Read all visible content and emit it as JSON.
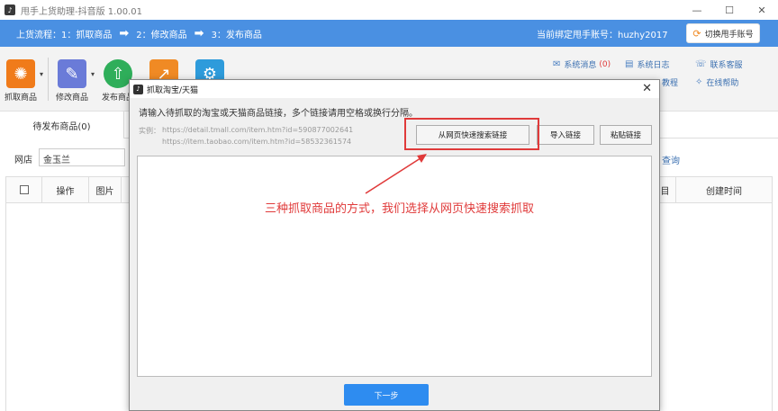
{
  "window": {
    "title": "甩手上货助理-抖音版 1.00.01",
    "controls": [
      "—",
      "☐",
      "✕"
    ]
  },
  "process": {
    "label": "上货流程：",
    "steps": [
      "1：抓取商品",
      "2：修改商品",
      "3：发布商品"
    ],
    "account_label": "当前绑定甩手账号：huzhy2017",
    "switch_button": "切换甩手账号"
  },
  "toolbar": {
    "tools": [
      {
        "label": "抓取商品",
        "icon": "spider-web-icon",
        "color": "#f07b1a"
      },
      {
        "label": "修改商品",
        "icon": "pencil-icon",
        "color": "#6a7bd8"
      },
      {
        "label": "发布商品",
        "icon": "upload-icon",
        "color": "#2fae5a"
      },
      {
        "label": "",
        "icon": "share-icon",
        "color": "#f08a24"
      },
      {
        "label": "",
        "icon": "gear-icon",
        "color": "#2e9bdb"
      }
    ],
    "links": {
      "messages": "系统消息",
      "messages_badge": "(0)",
      "logs": "系统日志",
      "contact": "联系客服",
      "tutorial": "教程",
      "help": "在线帮助"
    }
  },
  "tabs": {
    "active": "待发布商品(0)"
  },
  "filter": {
    "shop_label": "网店",
    "shop_value": "金玉兰",
    "query_link": "查询"
  },
  "table": {
    "headers": [
      "操作",
      "图片",
      "目",
      "创建时间"
    ]
  },
  "dialog": {
    "title": "抓取淘宝/天猫",
    "close": "✕",
    "instruction": "请输入待抓取的淘宝或天猫商品链接，多个链接请用空格或换行分隔。",
    "example_label": "实例：",
    "examples": [
      "https://detail.tmall.com/item.htm?id=590877002641",
      "https://item.taobao.com/item.htm?id=58532361574"
    ],
    "buttons": {
      "quick_search": "从网页快速搜索链接",
      "import": "导入链接",
      "paste": "粘贴链接"
    },
    "textarea_value": "",
    "annotation": "三种抓取商品的方式，我们选择从网页快速搜索抓取",
    "next_button": "下一步"
  },
  "colors": {
    "accent": "#4a90e2",
    "annotation": "#e03a3a",
    "primary_button": "#2e8cf0"
  }
}
